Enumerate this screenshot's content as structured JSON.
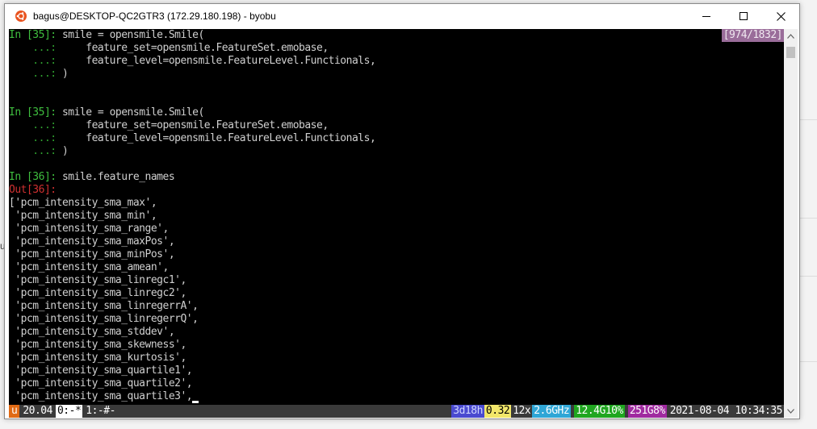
{
  "window": {
    "title": "bagus@DESKTOP-QC2GTR3 (172.29.180.198) - byobu",
    "minimize_icon": "minimize-icon",
    "maximize_icon": "maximize-icon",
    "close_icon": "close-icon",
    "app_icon": "ubuntu-logo-icon"
  },
  "background_app": {
    "fragment": "ur"
  },
  "terminal": {
    "position_indicator": "[974/1832]",
    "lines": [
      {
        "prompt": "In [35]: ",
        "text": "smile = opensmile.Smile("
      },
      {
        "prompt": "    ...: ",
        "text": "    feature_set=opensmile.FeatureSet.emobase,"
      },
      {
        "prompt": "    ...: ",
        "text": "    feature_level=opensmile.FeatureLevel.Functionals,"
      },
      {
        "prompt": "    ...: ",
        "text": ")"
      },
      {
        "prompt": "",
        "text": ""
      },
      {
        "prompt": "",
        "text": ""
      },
      {
        "prompt": "In [35]: ",
        "text": "smile = opensmile.Smile("
      },
      {
        "prompt": "    ...: ",
        "text": "    feature_set=opensmile.FeatureSet.emobase,"
      },
      {
        "prompt": "    ...: ",
        "text": "    feature_level=opensmile.FeatureLevel.Functionals,"
      },
      {
        "prompt": "    ...: ",
        "text": ")"
      },
      {
        "prompt": "",
        "text": ""
      },
      {
        "prompt": "In [36]: ",
        "text": "smile.feature_names"
      }
    ],
    "out_prompt": "Out[36]:",
    "output_lines": [
      "['pcm_intensity_sma_max',",
      " 'pcm_intensity_sma_min',",
      " 'pcm_intensity_sma_range',",
      " 'pcm_intensity_sma_maxPos',",
      " 'pcm_intensity_sma_minPos',",
      " 'pcm_intensity_sma_amean',",
      " 'pcm_intensity_sma_linregc1',",
      " 'pcm_intensity_sma_linregc2',",
      " 'pcm_intensity_sma_linregerrA',",
      " 'pcm_intensity_sma_linregerrQ',",
      " 'pcm_intensity_sma_stddev',",
      " 'pcm_intensity_sma_skewness',",
      " 'pcm_intensity_sma_kurtosis',",
      " 'pcm_intensity_sma_quartile1',",
      " 'pcm_intensity_sma_quartile2',",
      " 'pcm_intensity_sma_quartile3',"
    ]
  },
  "statusbar": {
    "distro": "u",
    "load": "20.04",
    "window0": "0:-*",
    "window1": "1:-#-",
    "uptime": "3d18h",
    "load_avg": "0.32",
    "cpu_count": "12x",
    "cpu_freq": "2.6GHz",
    "memory": "12.4G10%",
    "disk": "251G8%",
    "datetime": "2021-08-04 10:34:35"
  },
  "colors": {
    "terminal_bg": "#000000",
    "prompt_green": "#3fbf3f",
    "out_red": "#d03030",
    "distro_orange": "#e06a14"
  }
}
